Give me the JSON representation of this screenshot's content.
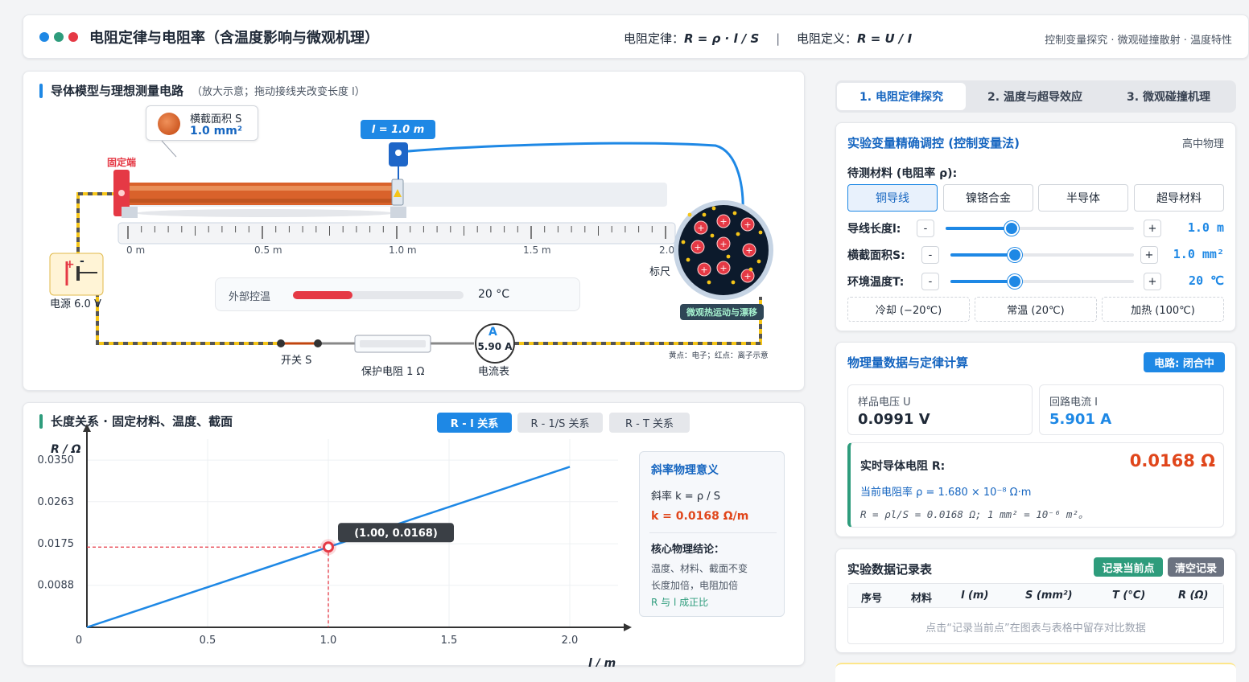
{
  "header": {
    "title": "电阻定律与电阻率（含温度影响与微观机理）",
    "law_label": "电阻定律：",
    "law_formula": "R = ρ · l / S",
    "sep": "|",
    "def_label": "电阻定义：",
    "def_formula": "R = U / I",
    "right_text": "控制变量探究 · 微观碰撞散射 · 温度特性",
    "dot_colors": [
      "#1e88e5",
      "#2e9c7c",
      "#e53945"
    ]
  },
  "circuit": {
    "title": "导体模型与理想测量电路",
    "subtitle": "（放大示意；拖动接线夹改变长度 l）",
    "area_label": "横截面积 S",
    "area_value": "1.0 mm²",
    "fixed_end": "固定端",
    "length_tag": "l = 1.0 m",
    "ruler_ticks": [
      "0 m",
      "0.5 m",
      "1.0 m",
      "1.5 m",
      "2.0"
    ],
    "ruler_label": "标尺",
    "source_label": "电源 6.0 V",
    "source_plus": "+",
    "source_minus": "-",
    "temp_control_label": "外部控温",
    "temp_value": "20 °C",
    "temp_fraction": 0.35,
    "switch_label": "开关 S",
    "resistor_label": "保护电阻 1 Ω",
    "ammeter_symbol": "A",
    "ammeter_reading": "5.90 A",
    "ammeter_label": "电流表",
    "micro_label": "微观热运动与漂移",
    "micro_legend": "黄点：电子；红点：离子示意"
  },
  "graph": {
    "title": "长度关系 · 固定材料、温度、截面",
    "tabs": [
      "R - l 关系",
      "R - 1/S 关系",
      "R - T 关系"
    ],
    "active_tab": 0,
    "info_title": "斜率物理意义",
    "slope_def": "斜率 k = ρ / S",
    "slope_value": "k = 0.0168 Ω/m",
    "conclusion_title": "核心物理结论：",
    "conclusion_1": "温度、材料、截面不变",
    "conclusion_2": "长度加倍，电阻加倍",
    "conclusion_3": "R 与 l 成正比",
    "point_tooltip": "(1.00, 0.0168)"
  },
  "chart_data": {
    "type": "line",
    "xlabel": "l / m",
    "ylabel": "R / Ω",
    "x_ticks": [
      "0",
      "0.5",
      "1.0",
      "1.5",
      "2.0"
    ],
    "y_ticks": [
      "0.0088",
      "0.0175",
      "0.0263",
      "0.0350"
    ],
    "xlim": [
      0,
      2.2
    ],
    "ylim": [
      0,
      0.0394
    ],
    "series": [
      {
        "x": [
          0,
          2.0
        ],
        "y": [
          0,
          0.0336
        ]
      }
    ],
    "highlight_point": {
      "x": 1.0,
      "y": 0.0168
    },
    "grid": true
  },
  "tabs": [
    "1. 电阻定律探究",
    "2. 温度与超导效应",
    "3. 微观碰撞机理"
  ],
  "active_tab": 0,
  "controls": {
    "title": "实验变量精确调控 (控制变量法)",
    "level": "高中物理",
    "material_label": "待测材料 (电阻率 ρ):",
    "materials": [
      "铜导线",
      "镍铬合金",
      "半导体",
      "超导材料"
    ],
    "active_material": 0,
    "length_label": "导线长度l:",
    "length_value": "1.0 m",
    "length_fraction": 0.35,
    "area_label": "横截面积S:",
    "area_value": "1.0 mm²",
    "area_fraction": 0.35,
    "temp_label": "环境温度T:",
    "temp_value": "20 ℃",
    "temp_fraction": 0.35,
    "minus": "-",
    "plus": "+",
    "presets": [
      "冷却 (−20℃)",
      "常温 (20℃)",
      "加热 (100℃)"
    ]
  },
  "data": {
    "title": "物理量数据与定律计算",
    "circuit_status": "电路: 闭合中",
    "voltage_label": "样品电压 U",
    "voltage_value": "0.0991 V",
    "current_label": "回路电流 I",
    "current_value": "5.901 A",
    "resistance_label": "实时导体电阻 R:",
    "resistance_value": "0.0168 Ω",
    "rho_line": "当前电阻率 ρ = 1.680 × 10⁻⁸ Ω·m",
    "calc_line": "R = ρl/S = 0.0168 Ω; 1 mm² = 10⁻⁶ m²。"
  },
  "records": {
    "title": "实验数据记录表",
    "record_button": "记录当前点",
    "clear_button": "清空记录",
    "columns": [
      "序号",
      "材料",
      "l (m)",
      "S (mm²)",
      "T (°C)",
      "R (Ω)"
    ],
    "empty_text": "点击“记录当前点”在图表与表格中留存对比数据"
  }
}
